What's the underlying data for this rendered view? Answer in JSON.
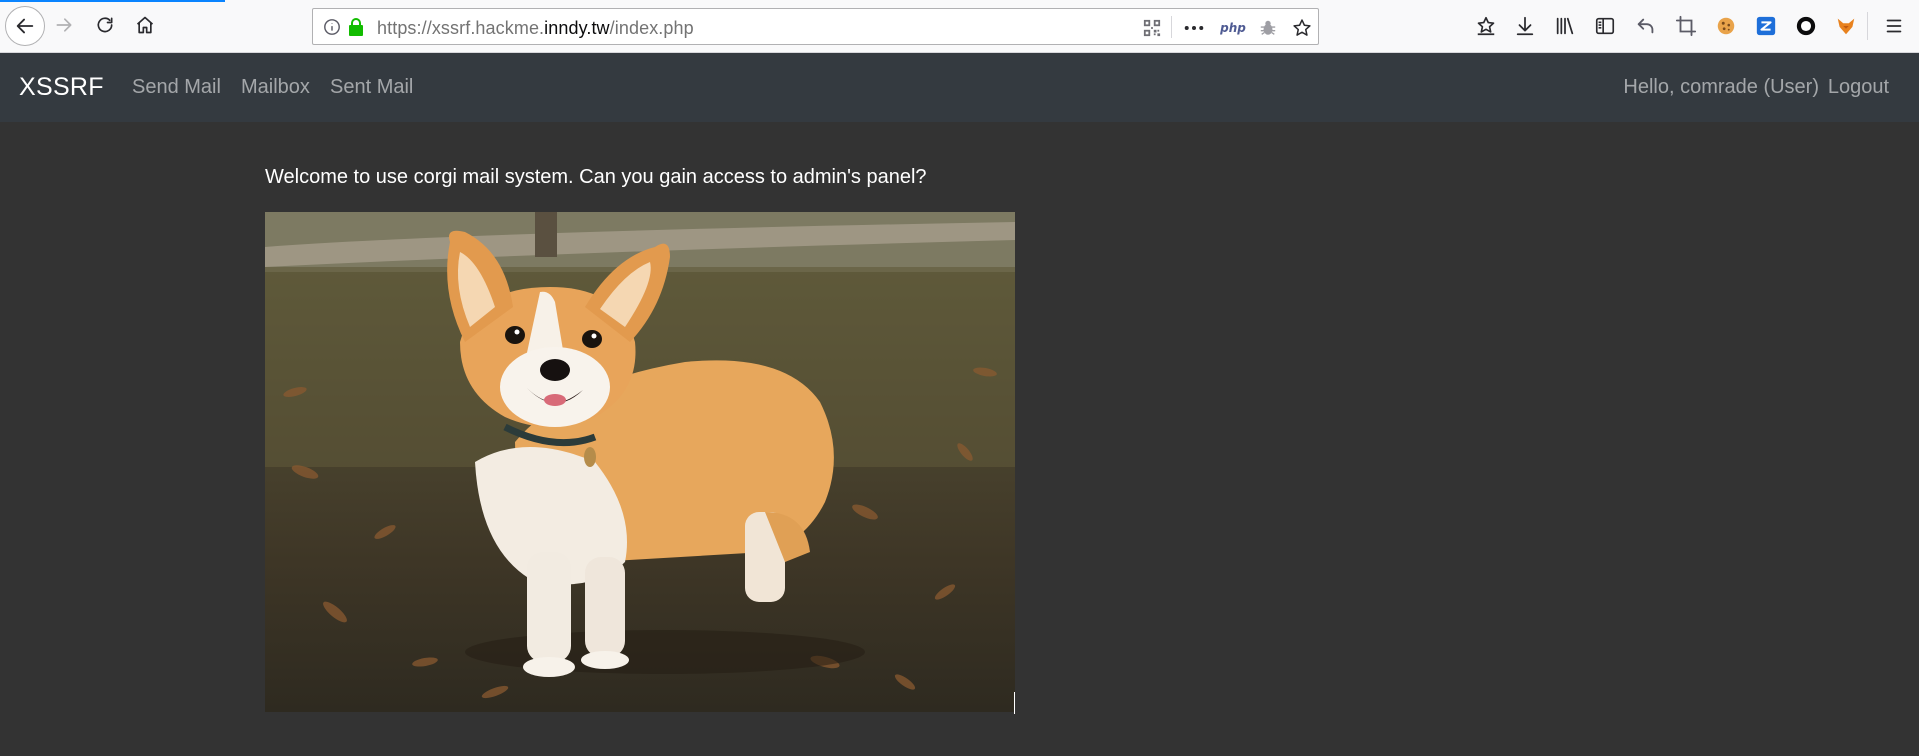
{
  "browser": {
    "url_scheme": "https://",
    "url_subdomain": "xssrf.hackme.",
    "url_host": "inndy.tw",
    "url_path": "/index.php",
    "php_badge": "php",
    "icons": {
      "back": "back-arrow-icon",
      "forward": "forward-arrow-icon",
      "reload": "reload-icon",
      "home": "home-icon",
      "info": "info-icon",
      "lock": "lock-icon",
      "qr": "qr-code-icon",
      "more": "more-dots-icon",
      "php": "php-extension-icon",
      "bug": "bug-icon",
      "bookmark": "star-icon",
      "right": [
        "reading-list-icon",
        "download-icon",
        "library-icon",
        "sidebar-icon",
        "undo-icon",
        "crop-icon",
        "cookie-icon",
        "zoom-extension-icon",
        "circle-extension-icon",
        "fox-extension-icon",
        "menu-icon"
      ]
    },
    "colors": {
      "lock": "#12bc00",
      "accent": "#0a84ff"
    }
  },
  "navbar": {
    "brand": "XSSRF",
    "links": {
      "send_mail": "Send Mail",
      "mailbox": "Mailbox",
      "sent_mail": "Sent Mail"
    },
    "greeting": "Hello, comrade (User)",
    "logout": "Logout",
    "background": "#343a40"
  },
  "main": {
    "welcome_text": "Welcome to use corgi mail system. Can you gain access to admin's panel?",
    "image_subject": "corgi dog standing on grass and fallen leaves"
  }
}
